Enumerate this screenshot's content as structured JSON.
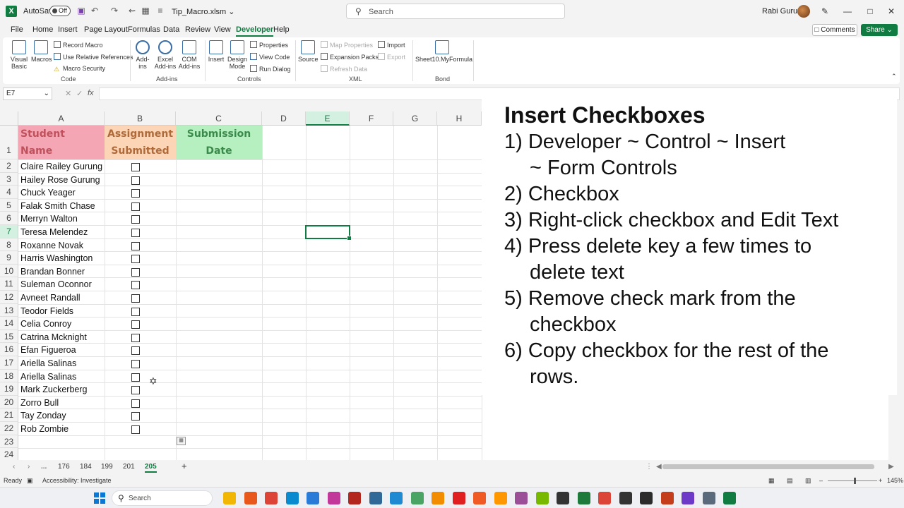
{
  "window": {
    "autosave_label": "AutoSave",
    "autosave_state": "Off",
    "filename": "Tip_Macro.xlsm",
    "search_placeholder": "Search",
    "user_name": "Rabi Gurung"
  },
  "menu": {
    "tabs": [
      "File",
      "Home",
      "Insert",
      "Page Layout",
      "Formulas",
      "Data",
      "Review",
      "View",
      "Developer",
      "Help"
    ],
    "active_tab": "Developer",
    "comments_label": "Comments",
    "share_label": "Share"
  },
  "ribbon": {
    "code": {
      "visual_basic": "Visual Basic",
      "macros": "Macros",
      "record_macro": "Record Macro",
      "relative_refs": "Use Relative References",
      "macro_security": "Macro Security",
      "label": "Code"
    },
    "addins": {
      "add_ins": "Add-ins",
      "excel_add_ins": "Excel Add-ins",
      "com_add_ins": "COM Add-ins",
      "label": "Add-ins"
    },
    "controls": {
      "insert": "Insert",
      "design_mode": "Design Mode",
      "properties": "Properties",
      "view_code": "View Code",
      "run_dialog": "Run Dialog",
      "label": "Controls"
    },
    "xml": {
      "source": "Source",
      "map_properties": "Map Properties",
      "expansion_packs": "Expansion Packs",
      "refresh_data": "Refresh Data",
      "import": "Import",
      "export": "Export",
      "label": "XML"
    },
    "bond": {
      "formula": "Sheet10.MyFormula",
      "label": "Bond"
    }
  },
  "formula_bar": {
    "name_box": "E7",
    "fx": "fx",
    "value": ""
  },
  "sheet": {
    "columns": [
      "A",
      "B",
      "C",
      "D",
      "E",
      "F",
      "G",
      "H"
    ],
    "selected_column": "E",
    "selected_row": "7",
    "rows": [
      "1",
      "2",
      "3",
      "4",
      "5",
      "6",
      "7",
      "8",
      "9",
      "10",
      "11",
      "12",
      "13",
      "14",
      "15",
      "16",
      "17",
      "18",
      "19",
      "20",
      "21",
      "22",
      "23",
      "24"
    ],
    "headers": {
      "a_line1": "Student",
      "a_line2": "Name",
      "b_line1": "Assignment",
      "b_line2": "Submitted",
      "c_line1": "Submission",
      "c_line2": "Date",
      "a_color": "#f4a6b4",
      "b_color": "#fbd5b5",
      "c_color": "#b6f0c0",
      "a_text_color": "#c0505c",
      "b_text_color": "#b06a3a",
      "c_text_color": "#3a8a4a"
    },
    "students": [
      "Claire Railey Gurung",
      "Hailey Rose Gurung",
      "Chuck Yeager",
      "Falak Smith Chase",
      "Merryn Walton",
      "Teresa Melendez",
      "Roxanne Novak",
      "Harris Washington",
      "Brandan Bonner",
      "Suleman Oconnor",
      "Avneet Randall",
      "Teodor Fields",
      "Celia Conroy",
      "Catrina Mcknight",
      "Efan Figueroa",
      "Ariella Salinas",
      "Ariella Salinas",
      "Mark Zuckerberg",
      "Zorro Bull",
      "Tay Zonday",
      "Rob Zombie"
    ],
    "checked": [
      false,
      false,
      false,
      false,
      false,
      false,
      false,
      false,
      false,
      false,
      false,
      false,
      false,
      false,
      false,
      false,
      false,
      false,
      false,
      false,
      false
    ]
  },
  "overlay": {
    "title": "Insert Checkboxes",
    "steps": [
      {
        "line1": "1) Developer ~ Control ~ Insert",
        "line2": "~ Form Controls"
      },
      {
        "line1": "2) Checkbox",
        "line2": ""
      },
      {
        "line1": "3) Right-click checkbox and Edit Text",
        "line2": ""
      },
      {
        "line1": "4) Press delete key a few times to",
        "line2": "delete text"
      },
      {
        "line1": "5) Remove check mark from the",
        "line2": "checkbox"
      },
      {
        "line1": "6) Copy checkbox for the rest of the",
        "line2": "rows."
      }
    ]
  },
  "sheet_tabs": {
    "tabs": [
      "176",
      "184",
      "199",
      "201",
      "205"
    ],
    "active": "205",
    "ellipsis": "...",
    "add": "+"
  },
  "status": {
    "ready": "Ready",
    "accessibility": "Accessibility: Investigate",
    "zoom": "145%"
  },
  "taskbar": {
    "search_placeholder": "Search"
  }
}
